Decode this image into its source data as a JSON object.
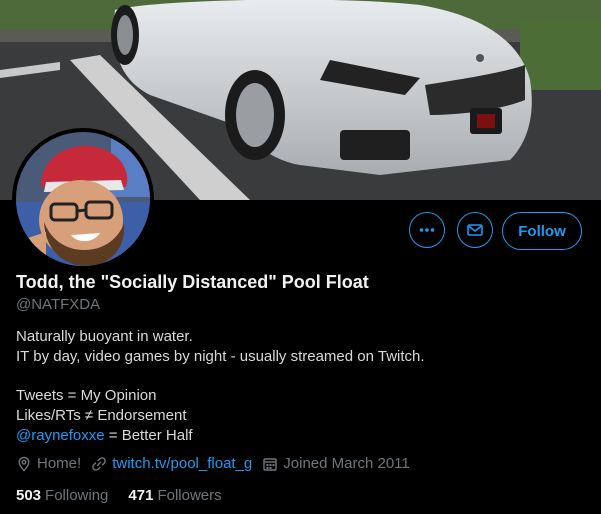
{
  "profile": {
    "name": "Todd, the \"Socially Distanced\" Pool Float",
    "handle": "@NATFXDA",
    "bio_lines": [
      "Naturally buoyant in water.",
      "IT by day, video games by night - usually streamed on Twitch.",
      "",
      "Tweets = My Opinion",
      "Likes/RTs ≠ Endorsement"
    ],
    "bio_mention": "@raynefoxxe",
    "bio_mention_suffix": " = Better Half",
    "location": "Home!",
    "website": "twitch.tv/pool_float_g",
    "joined": "Joined March 2011"
  },
  "actions": {
    "follow_label": "Follow",
    "more_icon": "more-icon",
    "message_icon": "envelope-icon"
  },
  "stats": {
    "following_count": "503",
    "following_label": "Following",
    "followers_count": "471",
    "followers_label": "Followers"
  },
  "colors": {
    "accent": "#1d9bf0",
    "background": "#000000",
    "secondary_text": "#6e767d"
  }
}
